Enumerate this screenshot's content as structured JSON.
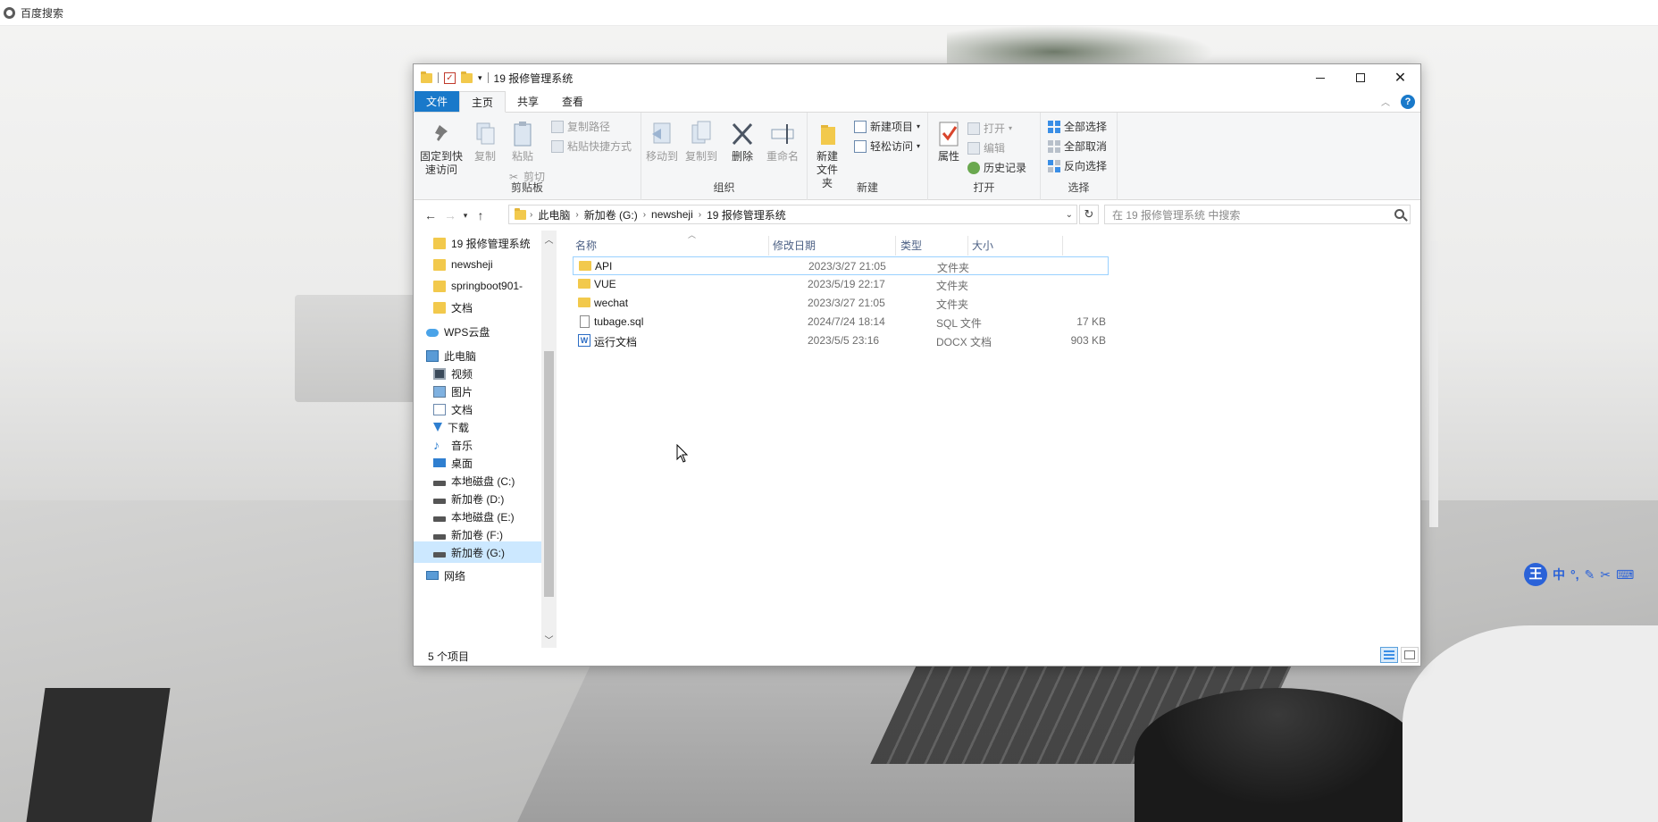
{
  "browser_bar": {
    "title": "百度搜索"
  },
  "window": {
    "title": "19 报修管理系统",
    "tabs": [
      "文件",
      "主页",
      "共享",
      "查看"
    ],
    "ribbon": {
      "clipboard": {
        "group": "剪贴板",
        "pin": "固定到快速访问",
        "copy": "复制",
        "paste": "粘贴",
        "copy_path": "复制路径",
        "paste_shortcut": "粘贴快捷方式",
        "cut": "剪切"
      },
      "organize": {
        "group": "组织",
        "move_to": "移动到",
        "copy_to": "复制到",
        "delete": "删除",
        "rename": "重命名"
      },
      "new": {
        "group": "新建",
        "new_folder": "新建文件夹",
        "new_item": "新建项目",
        "easy_access": "轻松访问"
      },
      "open": {
        "group": "打开",
        "properties": "属性",
        "open": "打开",
        "edit": "编辑",
        "history": "历史记录"
      },
      "select": {
        "group": "选择",
        "select_all": "全部选择",
        "select_none": "全部取消",
        "invert": "反向选择"
      }
    },
    "address": {
      "crumbs": [
        "此电脑",
        "新加卷 (G:)",
        "newsheji",
        "19 报修管理系统"
      ]
    },
    "search": {
      "placeholder": "在 19 报修管理系统 中搜索"
    },
    "nav_items": [
      {
        "label": "19 报修管理系统",
        "icon": "folder-icon"
      },
      {
        "label": "newsheji",
        "icon": "folder-icon"
      },
      {
        "label": "springboot901-",
        "icon": "folder-icon"
      },
      {
        "label": "文档",
        "icon": "folder-icon"
      },
      {
        "label": "WPS云盘",
        "icon": "cloud-icon"
      },
      {
        "label": "此电脑",
        "icon": "computer-icon"
      },
      {
        "label": "视频",
        "icon": "video-icon"
      },
      {
        "label": "图片",
        "icon": "picture-icon"
      },
      {
        "label": "文档",
        "icon": "document-icon"
      },
      {
        "label": "下载",
        "icon": "download-icon"
      },
      {
        "label": "音乐",
        "icon": "music-icon"
      },
      {
        "label": "桌面",
        "icon": "desktop-icon"
      },
      {
        "label": "本地磁盘 (C:)",
        "icon": "drive-icon"
      },
      {
        "label": "新加卷 (D:)",
        "icon": "drive-icon"
      },
      {
        "label": "本地磁盘 (E:)",
        "icon": "drive-icon"
      },
      {
        "label": "新加卷 (F:)",
        "icon": "drive-icon"
      },
      {
        "label": "新加卷 (G:)",
        "icon": "drive-icon",
        "selected": true
      },
      {
        "label": "网络",
        "icon": "network-icon"
      }
    ],
    "columns": [
      "名称",
      "修改日期",
      "类型",
      "大小"
    ],
    "files": [
      {
        "name": "API",
        "date": "2023/3/27 21:05",
        "type": "文件夹",
        "size": "",
        "icon": "folder-icon"
      },
      {
        "name": "VUE",
        "date": "2023/5/19 22:17",
        "type": "文件夹",
        "size": "",
        "icon": "folder-icon"
      },
      {
        "name": "wechat",
        "date": "2023/3/27 21:05",
        "type": "文件夹",
        "size": "",
        "icon": "folder-icon"
      },
      {
        "name": "tubage.sql",
        "date": "2024/7/24 18:14",
        "type": "SQL 文件",
        "size": "17 KB",
        "icon": "file-icon"
      },
      {
        "name": "运行文档",
        "date": "2023/5/5 23:16",
        "type": "DOCX 文档",
        "size": "903 KB",
        "icon": "word-doc-icon"
      }
    ],
    "status": "5 个项目"
  },
  "ime": {
    "logo": "王",
    "mode": "中"
  },
  "colors": {
    "accent": "#1979ca",
    "folder": "#f2c94c",
    "selection": "#cce8ff"
  }
}
